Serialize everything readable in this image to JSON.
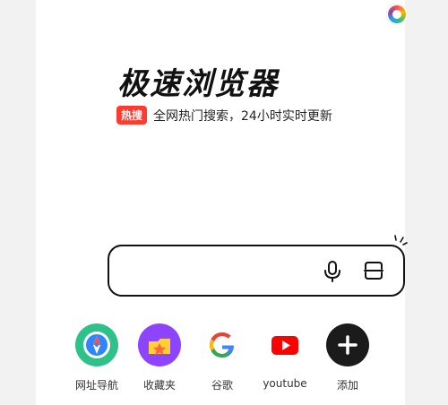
{
  "header": {
    "title": "极速浏览器"
  },
  "hot": {
    "badge": "热搜",
    "text": "全网热门搜索，24小时实时更新"
  },
  "search": {
    "value": "",
    "placeholder": ""
  },
  "shortcuts": [
    {
      "label": "网址导航",
      "icon": "compass-icon"
    },
    {
      "label": "收藏夹",
      "icon": "star-folder-icon"
    },
    {
      "label": "谷歌",
      "icon": "google-icon"
    },
    {
      "label": "youtube",
      "icon": "youtube-icon"
    },
    {
      "label": "添加",
      "icon": "plus-icon"
    }
  ],
  "colors": {
    "accent_red": "#ff3b30",
    "nav_green": "#2ec28a",
    "fav_purple": "#8e44ff",
    "youtube_red": "#ff0000",
    "dark": "#1b1b1b"
  }
}
